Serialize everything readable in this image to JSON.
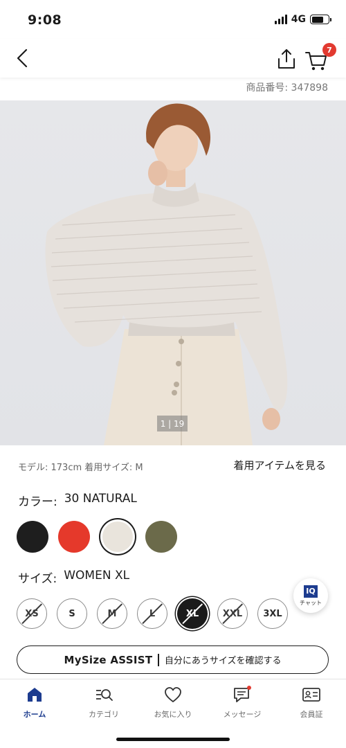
{
  "status_bar": {
    "time": "9:08",
    "network": "4G"
  },
  "header": {
    "cart_count": "7"
  },
  "product": {
    "code_text": "商品番号: 347898",
    "image_counter": "1 | 19",
    "model_info": "モデル: 173cm 着用サイズ: M",
    "see_items": "着用アイテムを見る"
  },
  "color": {
    "label": "カラー:",
    "value": "30 NATURAL",
    "swatches": [
      {
        "name": "black",
        "color": "#1e1e1e"
      },
      {
        "name": "red",
        "color": "#e5392b"
      },
      {
        "name": "natural",
        "color": "#e9e4dc",
        "selected": true
      },
      {
        "name": "olive",
        "color": "#6b6a4a"
      }
    ]
  },
  "size": {
    "label": "サイズ:",
    "value": "WOMEN XL",
    "options": [
      {
        "label": "XS",
        "available": false
      },
      {
        "label": "S",
        "available": true
      },
      {
        "label": "M",
        "available": false
      },
      {
        "label": "L",
        "available": false
      },
      {
        "label": "XL",
        "available": true,
        "selected": true
      },
      {
        "label": "XXL",
        "available": false
      },
      {
        "label": "3XL",
        "available": true
      }
    ]
  },
  "chat": {
    "logo": "IQ",
    "label": "チャット"
  },
  "mysize": {
    "brand": "MySize ASSIST",
    "text": "自分にあうサイズを確認する"
  },
  "tabs": [
    {
      "label": "ホーム",
      "icon": "home-icon",
      "active": true
    },
    {
      "label": "カテゴリ",
      "icon": "category-search-icon"
    },
    {
      "label": "お気に入り",
      "icon": "heart-icon"
    },
    {
      "label": "メッセージ",
      "icon": "message-icon"
    },
    {
      "label": "会員証",
      "icon": "member-card-icon"
    }
  ],
  "colors": {
    "accent": "#1d3c8f",
    "badge": "#e23a30"
  }
}
